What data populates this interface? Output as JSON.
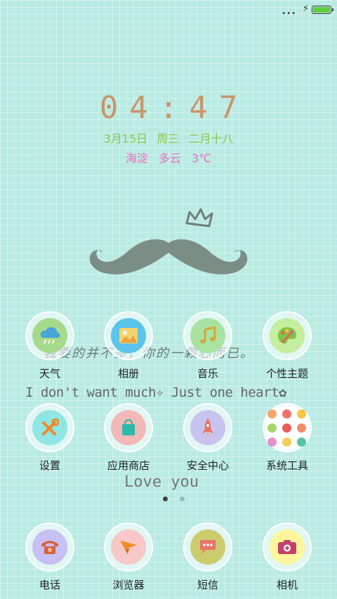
{
  "status_bar": {
    "dots": "•••",
    "charging_icon": "lightning-bolt",
    "battery_level": 1.0,
    "battery_color": "#5ccf3d"
  },
  "lock_clock": {
    "time": "04:47",
    "date": "3月15日",
    "weekday": "周三",
    "lunar": "二月十八",
    "location": "海淀",
    "weather": "多云",
    "temperature": "3℃",
    "time_color": "#c9956a",
    "date_color": "#8fc64c",
    "weather_color": "#e472c4"
  },
  "wallpaper": {
    "line_cn": "我要的并不多，你的一颗心而已。",
    "line_en": "I don't want much✧ Just one heart✿",
    "line_love": "Love you",
    "background_color": "#b9ebe3"
  },
  "apps": [
    {
      "label": "天气",
      "icon": "weather-rain-icon",
      "color": "#a7d98d"
    },
    {
      "label": "相册",
      "icon": "gallery-icon",
      "color": "#5bc4ea"
    },
    {
      "label": "音乐",
      "icon": "music-note-icon",
      "color": "#a9e3a1"
    },
    {
      "label": "个性主题",
      "icon": "theme-palette-icon",
      "color": "#c5eea0"
    },
    {
      "label": "设置",
      "icon": "settings-tools-icon",
      "color": "#8fe6e4"
    },
    {
      "label": "应用商店",
      "icon": "shopping-bag-icon",
      "color": "#f3b8b8"
    },
    {
      "label": "安全中心",
      "icon": "rocket-icon",
      "color": "#c9c3ef"
    },
    {
      "label": "系统工具",
      "icon": "folder-icon",
      "color": "#ffffff"
    }
  ],
  "pager": {
    "pages": 2,
    "current": 1
  },
  "dock": [
    {
      "label": "电话",
      "icon": "phone-icon",
      "color": "#c6c0f4"
    },
    {
      "label": "浏览器",
      "icon": "paper-plane-icon",
      "color": "#f8c8c8"
    },
    {
      "label": "短信",
      "icon": "message-icon",
      "color": "#cbcc6e"
    },
    {
      "label": "相机",
      "icon": "camera-icon",
      "color": "#fff59c"
    }
  ]
}
